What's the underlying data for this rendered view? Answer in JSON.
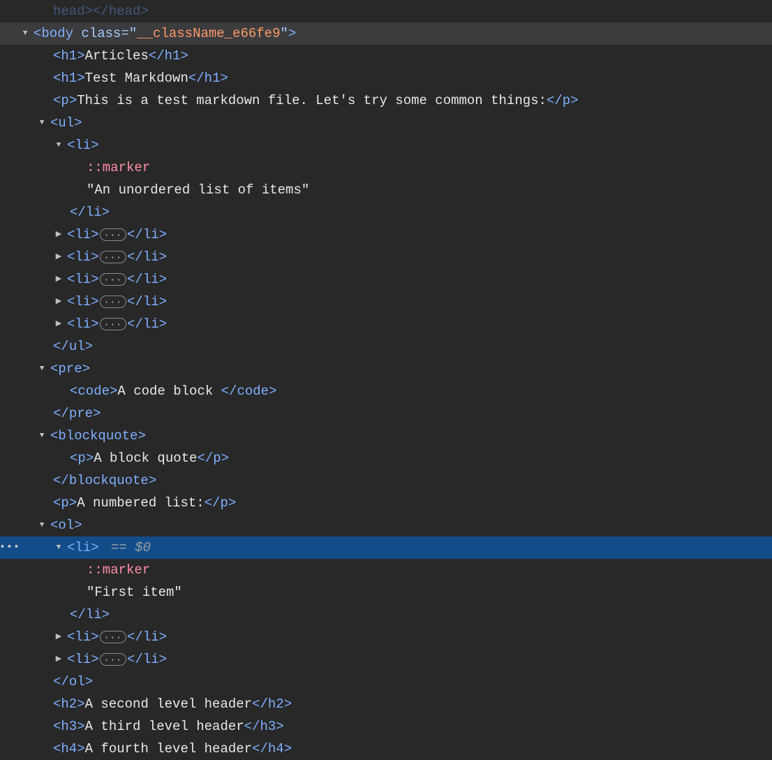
{
  "triangles": {
    "down": "▼",
    "right": "▶"
  },
  "ellipsis": "···",
  "gutter_dots": "•••",
  "lines": [
    {
      "indent": 1,
      "toggle": "none",
      "faded": true,
      "parts": [
        {
          "t": "tag",
          "v": "head"
        },
        {
          "t": "bracket",
          "v": ">"
        },
        {
          "t": "bracket",
          "v": "</"
        },
        {
          "t": "tag",
          "v": "head"
        },
        {
          "t": "bracket",
          "v": ">"
        }
      ],
      "pad_left": true
    },
    {
      "indent": 0,
      "toggle": "down",
      "highlight": "gray",
      "parts": [
        {
          "t": "bracket",
          "v": "<"
        },
        {
          "t": "tag",
          "v": "body "
        },
        {
          "t": "attr-name",
          "v": "class"
        },
        {
          "t": "attr-eq",
          "v": "=\""
        },
        {
          "t": "attr-str",
          "v": "__className_e66fe9"
        },
        {
          "t": "attr-eq",
          "v": "\""
        },
        {
          "t": "bracket",
          "v": ">"
        }
      ]
    },
    {
      "indent": 1,
      "toggle": "none",
      "pad_left": true,
      "parts": [
        {
          "t": "bracket",
          "v": "<"
        },
        {
          "t": "tag",
          "v": "h1"
        },
        {
          "t": "bracket",
          "v": ">"
        },
        {
          "t": "text",
          "v": "Articles"
        },
        {
          "t": "bracket",
          "v": "</"
        },
        {
          "t": "tag",
          "v": "h1"
        },
        {
          "t": "bracket",
          "v": ">"
        }
      ]
    },
    {
      "indent": 1,
      "toggle": "none",
      "pad_left": true,
      "parts": [
        {
          "t": "bracket",
          "v": "<"
        },
        {
          "t": "tag",
          "v": "h1"
        },
        {
          "t": "bracket",
          "v": ">"
        },
        {
          "t": "text",
          "v": "Test Markdown"
        },
        {
          "t": "bracket",
          "v": "</"
        },
        {
          "t": "tag",
          "v": "h1"
        },
        {
          "t": "bracket",
          "v": ">"
        }
      ]
    },
    {
      "indent": 1,
      "toggle": "none",
      "pad_left": true,
      "parts": [
        {
          "t": "bracket",
          "v": "<"
        },
        {
          "t": "tag",
          "v": "p"
        },
        {
          "t": "bracket",
          "v": ">"
        },
        {
          "t": "text",
          "v": "This is a test markdown file. Let's try some common things:"
        },
        {
          "t": "bracket",
          "v": "</"
        },
        {
          "t": "tag",
          "v": "p"
        },
        {
          "t": "bracket",
          "v": ">"
        }
      ]
    },
    {
      "indent": 1,
      "toggle": "down",
      "parts": [
        {
          "t": "bracket",
          "v": "<"
        },
        {
          "t": "tag",
          "v": "ul"
        },
        {
          "t": "bracket",
          "v": ">"
        }
      ]
    },
    {
      "indent": 2,
      "toggle": "down",
      "parts": [
        {
          "t": "bracket",
          "v": "<"
        },
        {
          "t": "tag",
          "v": "li"
        },
        {
          "t": "bracket",
          "v": ">"
        }
      ]
    },
    {
      "indent": 3,
      "toggle": "none",
      "pad_left": true,
      "parts": [
        {
          "t": "pseudo",
          "v": "::marker"
        }
      ]
    },
    {
      "indent": 3,
      "toggle": "none",
      "pad_left": true,
      "parts": [
        {
          "t": "quoted",
          "v": "\"An unordered list of items\""
        }
      ]
    },
    {
      "indent": 2,
      "toggle": "none",
      "pad_left": true,
      "parts": [
        {
          "t": "bracket",
          "v": "</"
        },
        {
          "t": "tag",
          "v": "li"
        },
        {
          "t": "bracket",
          "v": ">"
        }
      ]
    },
    {
      "indent": 2,
      "toggle": "right",
      "parts": [
        {
          "t": "bracket",
          "v": "<"
        },
        {
          "t": "tag",
          "v": "li"
        },
        {
          "t": "bracket",
          "v": ">"
        },
        {
          "t": "pill",
          "v": ""
        },
        {
          "t": "bracket",
          "v": "</"
        },
        {
          "t": "tag",
          "v": "li"
        },
        {
          "t": "bracket",
          "v": ">"
        }
      ]
    },
    {
      "indent": 2,
      "toggle": "right",
      "parts": [
        {
          "t": "bracket",
          "v": "<"
        },
        {
          "t": "tag",
          "v": "li"
        },
        {
          "t": "bracket",
          "v": ">"
        },
        {
          "t": "pill",
          "v": ""
        },
        {
          "t": "bracket",
          "v": "</"
        },
        {
          "t": "tag",
          "v": "li"
        },
        {
          "t": "bracket",
          "v": ">"
        }
      ]
    },
    {
      "indent": 2,
      "toggle": "right",
      "parts": [
        {
          "t": "bracket",
          "v": "<"
        },
        {
          "t": "tag",
          "v": "li"
        },
        {
          "t": "bracket",
          "v": ">"
        },
        {
          "t": "pill",
          "v": ""
        },
        {
          "t": "bracket",
          "v": "</"
        },
        {
          "t": "tag",
          "v": "li"
        },
        {
          "t": "bracket",
          "v": ">"
        }
      ]
    },
    {
      "indent": 2,
      "toggle": "right",
      "parts": [
        {
          "t": "bracket",
          "v": "<"
        },
        {
          "t": "tag",
          "v": "li"
        },
        {
          "t": "bracket",
          "v": ">"
        },
        {
          "t": "pill",
          "v": ""
        },
        {
          "t": "bracket",
          "v": "</"
        },
        {
          "t": "tag",
          "v": "li"
        },
        {
          "t": "bracket",
          "v": ">"
        }
      ]
    },
    {
      "indent": 2,
      "toggle": "right",
      "parts": [
        {
          "t": "bracket",
          "v": "<"
        },
        {
          "t": "tag",
          "v": "li"
        },
        {
          "t": "bracket",
          "v": ">"
        },
        {
          "t": "pill",
          "v": ""
        },
        {
          "t": "bracket",
          "v": "</"
        },
        {
          "t": "tag",
          "v": "li"
        },
        {
          "t": "bracket",
          "v": ">"
        }
      ]
    },
    {
      "indent": 1,
      "toggle": "none",
      "pad_left": true,
      "parts": [
        {
          "t": "bracket",
          "v": "</"
        },
        {
          "t": "tag",
          "v": "ul"
        },
        {
          "t": "bracket",
          "v": ">"
        }
      ]
    },
    {
      "indent": 1,
      "toggle": "down",
      "parts": [
        {
          "t": "bracket",
          "v": "<"
        },
        {
          "t": "tag",
          "v": "pre"
        },
        {
          "t": "bracket",
          "v": ">"
        }
      ]
    },
    {
      "indent": 2,
      "toggle": "none",
      "pad_left": true,
      "parts": [
        {
          "t": "bracket",
          "v": "<"
        },
        {
          "t": "tag",
          "v": "code"
        },
        {
          "t": "bracket",
          "v": ">"
        },
        {
          "t": "text",
          "v": "A code block "
        },
        {
          "t": "bracket",
          "v": "</"
        },
        {
          "t": "tag",
          "v": "code"
        },
        {
          "t": "bracket",
          "v": ">"
        }
      ]
    },
    {
      "indent": 1,
      "toggle": "none",
      "pad_left": true,
      "parts": [
        {
          "t": "bracket",
          "v": "</"
        },
        {
          "t": "tag",
          "v": "pre"
        },
        {
          "t": "bracket",
          "v": ">"
        }
      ]
    },
    {
      "indent": 1,
      "toggle": "down",
      "parts": [
        {
          "t": "bracket",
          "v": "<"
        },
        {
          "t": "tag",
          "v": "blockquote"
        },
        {
          "t": "bracket",
          "v": ">"
        }
      ]
    },
    {
      "indent": 2,
      "toggle": "none",
      "pad_left": true,
      "parts": [
        {
          "t": "bracket",
          "v": "<"
        },
        {
          "t": "tag",
          "v": "p"
        },
        {
          "t": "bracket",
          "v": ">"
        },
        {
          "t": "text",
          "v": "A block quote"
        },
        {
          "t": "bracket",
          "v": "</"
        },
        {
          "t": "tag",
          "v": "p"
        },
        {
          "t": "bracket",
          "v": ">"
        }
      ]
    },
    {
      "indent": 1,
      "toggle": "none",
      "pad_left": true,
      "parts": [
        {
          "t": "bracket",
          "v": "</"
        },
        {
          "t": "tag",
          "v": "blockquote"
        },
        {
          "t": "bracket",
          "v": ">"
        }
      ]
    },
    {
      "indent": 1,
      "toggle": "none",
      "pad_left": true,
      "parts": [
        {
          "t": "bracket",
          "v": "<"
        },
        {
          "t": "tag",
          "v": "p"
        },
        {
          "t": "bracket",
          "v": ">"
        },
        {
          "t": "text",
          "v": "A numbered list:"
        },
        {
          "t": "bracket",
          "v": "</"
        },
        {
          "t": "tag",
          "v": "p"
        },
        {
          "t": "bracket",
          "v": ">"
        }
      ]
    },
    {
      "indent": 1,
      "toggle": "down",
      "parts": [
        {
          "t": "bracket",
          "v": "<"
        },
        {
          "t": "tag",
          "v": "ol"
        },
        {
          "t": "bracket",
          "v": ">"
        }
      ]
    },
    {
      "indent": 2,
      "toggle": "down",
      "highlight": "blue",
      "gutter_dots": true,
      "parts": [
        {
          "t": "bracket",
          "v": "<"
        },
        {
          "t": "tag",
          "v": "li"
        },
        {
          "t": "bracket",
          "v": ">"
        },
        {
          "t": "sel-hint",
          "v": " == $0"
        }
      ]
    },
    {
      "indent": 3,
      "toggle": "none",
      "pad_left": true,
      "parts": [
        {
          "t": "pseudo",
          "v": "::marker"
        }
      ]
    },
    {
      "indent": 3,
      "toggle": "none",
      "pad_left": true,
      "parts": [
        {
          "t": "quoted",
          "v": "\"First item\""
        }
      ]
    },
    {
      "indent": 2,
      "toggle": "none",
      "pad_left": true,
      "parts": [
        {
          "t": "bracket",
          "v": "</"
        },
        {
          "t": "tag",
          "v": "li"
        },
        {
          "t": "bracket",
          "v": ">"
        }
      ]
    },
    {
      "indent": 2,
      "toggle": "right",
      "parts": [
        {
          "t": "bracket",
          "v": "<"
        },
        {
          "t": "tag",
          "v": "li"
        },
        {
          "t": "bracket",
          "v": ">"
        },
        {
          "t": "pill",
          "v": ""
        },
        {
          "t": "bracket",
          "v": "</"
        },
        {
          "t": "tag",
          "v": "li"
        },
        {
          "t": "bracket",
          "v": ">"
        }
      ]
    },
    {
      "indent": 2,
      "toggle": "right",
      "parts": [
        {
          "t": "bracket",
          "v": "<"
        },
        {
          "t": "tag",
          "v": "li"
        },
        {
          "t": "bracket",
          "v": ">"
        },
        {
          "t": "pill",
          "v": ""
        },
        {
          "t": "bracket",
          "v": "</"
        },
        {
          "t": "tag",
          "v": "li"
        },
        {
          "t": "bracket",
          "v": ">"
        }
      ]
    },
    {
      "indent": 1,
      "toggle": "none",
      "pad_left": true,
      "parts": [
        {
          "t": "bracket",
          "v": "</"
        },
        {
          "t": "tag",
          "v": "ol"
        },
        {
          "t": "bracket",
          "v": ">"
        }
      ]
    },
    {
      "indent": 1,
      "toggle": "none",
      "pad_left": true,
      "parts": [
        {
          "t": "bracket",
          "v": "<"
        },
        {
          "t": "tag",
          "v": "h2"
        },
        {
          "t": "bracket",
          "v": ">"
        },
        {
          "t": "text",
          "v": "A second level header"
        },
        {
          "t": "bracket",
          "v": "</"
        },
        {
          "t": "tag",
          "v": "h2"
        },
        {
          "t": "bracket",
          "v": ">"
        }
      ]
    },
    {
      "indent": 1,
      "toggle": "none",
      "pad_left": true,
      "parts": [
        {
          "t": "bracket",
          "v": "<"
        },
        {
          "t": "tag",
          "v": "h3"
        },
        {
          "t": "bracket",
          "v": ">"
        },
        {
          "t": "text",
          "v": "A third level header"
        },
        {
          "t": "bracket",
          "v": "</"
        },
        {
          "t": "tag",
          "v": "h3"
        },
        {
          "t": "bracket",
          "v": ">"
        }
      ]
    },
    {
      "indent": 1,
      "toggle": "none",
      "pad_left": true,
      "parts": [
        {
          "t": "bracket",
          "v": "<"
        },
        {
          "t": "tag",
          "v": "h4"
        },
        {
          "t": "bracket",
          "v": ">"
        },
        {
          "t": "text",
          "v": "A fourth level header"
        },
        {
          "t": "bracket",
          "v": "</"
        },
        {
          "t": "tag",
          "v": "h4"
        },
        {
          "t": "bracket",
          "v": ">"
        }
      ]
    }
  ]
}
